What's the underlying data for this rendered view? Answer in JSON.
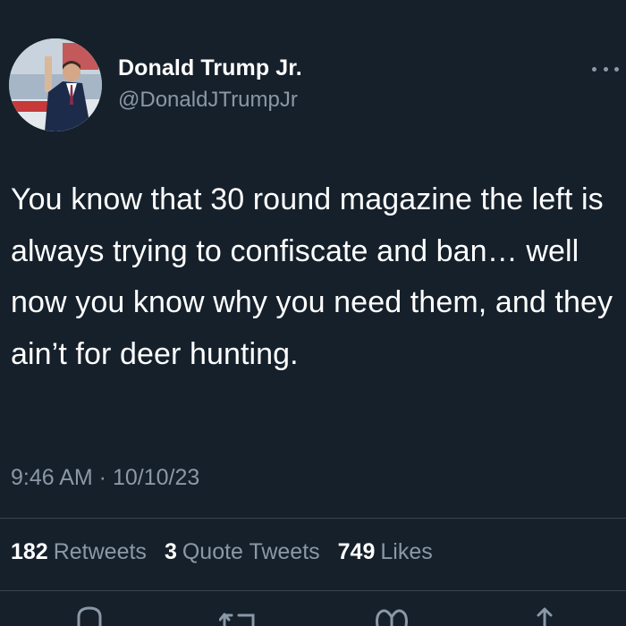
{
  "tweet": {
    "author_name": "Donald Trump Jr.",
    "author_handle": "@DonaldJTrumpJr",
    "text": "You know that 30 round magazine the left is always trying to confiscate and ban… well now you know why you need them, and they ain’t for deer hunting.",
    "timestamp": "9:46 AM · 10/10/23"
  },
  "stats": {
    "retweets_count": "182",
    "retweets_label": "Retweets",
    "quotes_count": "3",
    "quotes_label": "Quote Tweets",
    "likes_count": "749",
    "likes_label": "Likes"
  },
  "icons": {
    "more": "more-icon",
    "reply": "reply-icon",
    "retweet": "retweet-icon",
    "like": "heart-icon",
    "share": "share-icon"
  },
  "colors": {
    "background": "#15202b",
    "text": "#ffffff",
    "secondary": "#8b98a5",
    "divider": "#38444d"
  }
}
